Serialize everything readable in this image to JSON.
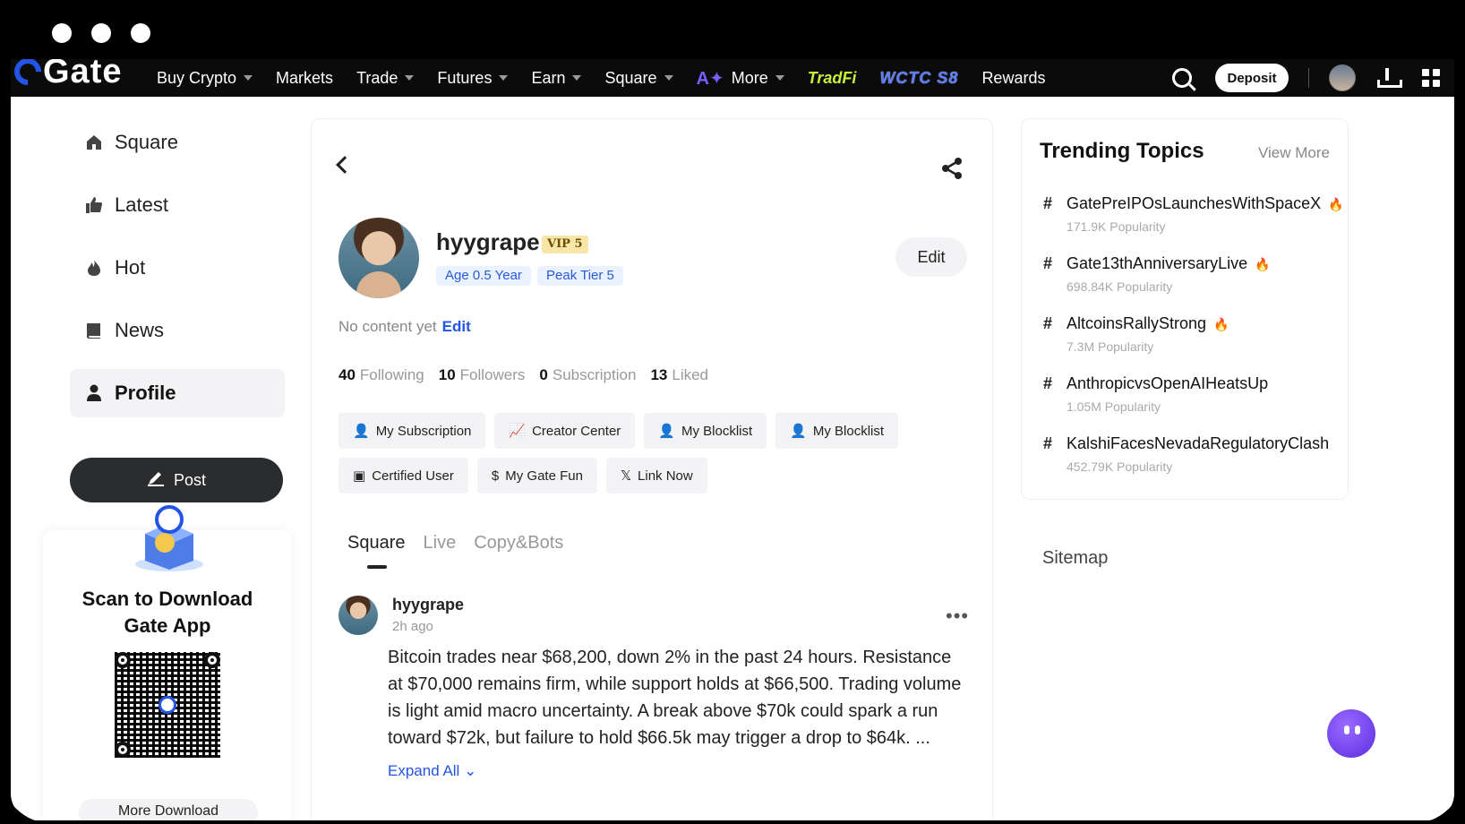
{
  "nav": {
    "logo": "Gate",
    "links": [
      "Buy Crypto",
      "Markets",
      "Trade",
      "Futures",
      "Earn",
      "Square",
      "More"
    ],
    "tradfi": "TradFi",
    "wctc": "WCTC S8",
    "rewards": "Rewards",
    "deposit": "Deposit"
  },
  "sidebar": {
    "items": [
      {
        "label": "Square",
        "icon": "home-icon"
      },
      {
        "label": "Latest",
        "icon": "thumbs-up-icon"
      },
      {
        "label": "Hot",
        "icon": "flame-icon"
      },
      {
        "label": "News",
        "icon": "book-icon"
      },
      {
        "label": "Profile",
        "icon": "person-icon"
      }
    ],
    "post_label": "Post",
    "download_title_line1": "Scan to Download",
    "download_title_line2": "Gate App",
    "more_download": "More Download"
  },
  "profile": {
    "username": "hyygrape",
    "vip": "VIP 5",
    "age": "Age 0.5 Year",
    "peak_tier": "Peak Tier 5",
    "edit": "Edit",
    "no_content": "No content yet",
    "no_content_edit": "Edit",
    "stats": [
      {
        "num": "40",
        "label": "Following"
      },
      {
        "num": "10",
        "label": "Followers"
      },
      {
        "num": "0",
        "label": "Subscription"
      },
      {
        "num": "13",
        "label": "Liked"
      }
    ],
    "buttons_row1": [
      "My Subscription",
      "Creator Center",
      "My Blocklist",
      "My Blocklist"
    ],
    "buttons_row2": [
      "Certified User",
      "My Gate Fun",
      "Link Now"
    ],
    "tabs": [
      "Square",
      "Live",
      "Copy&Bots"
    ]
  },
  "post": {
    "user": "hyygrape",
    "time": "2h ago",
    "text": "Bitcoin trades near $68,200, down 2% in the past 24 hours. Resistance at $70,000 remains firm, while support holds at $66,500. Trading volume is light amid macro uncertainty. A break above $70k could spark a run toward $72k, but failure to hold $66.5k may trigger a drop to $64k. ...",
    "expand": "Expand All"
  },
  "trending": {
    "title": "Trending Topics",
    "view_more": "View More",
    "topics": [
      {
        "name": "GatePreIPOsLaunchesWithSpaceX",
        "popularity": "171.9K Popularity",
        "hot": true
      },
      {
        "name": "Gate13thAnniversaryLive",
        "popularity": "698.84K Popularity",
        "hot": true
      },
      {
        "name": "AltcoinsRallyStrong",
        "popularity": "7.3M Popularity",
        "hot": true
      },
      {
        "name": "AnthropicvsOpenAIHeatsUp",
        "popularity": "1.05M Popularity",
        "hot": false
      },
      {
        "name": "KalshiFacesNevadaRegulatoryClash",
        "popularity": "452.79K Popularity",
        "hot": false
      }
    ]
  },
  "sitemap": "Sitemap",
  "colors": {
    "accent": "#2354e6",
    "flame": "#f0533c",
    "bot": "#6a3cf0"
  }
}
